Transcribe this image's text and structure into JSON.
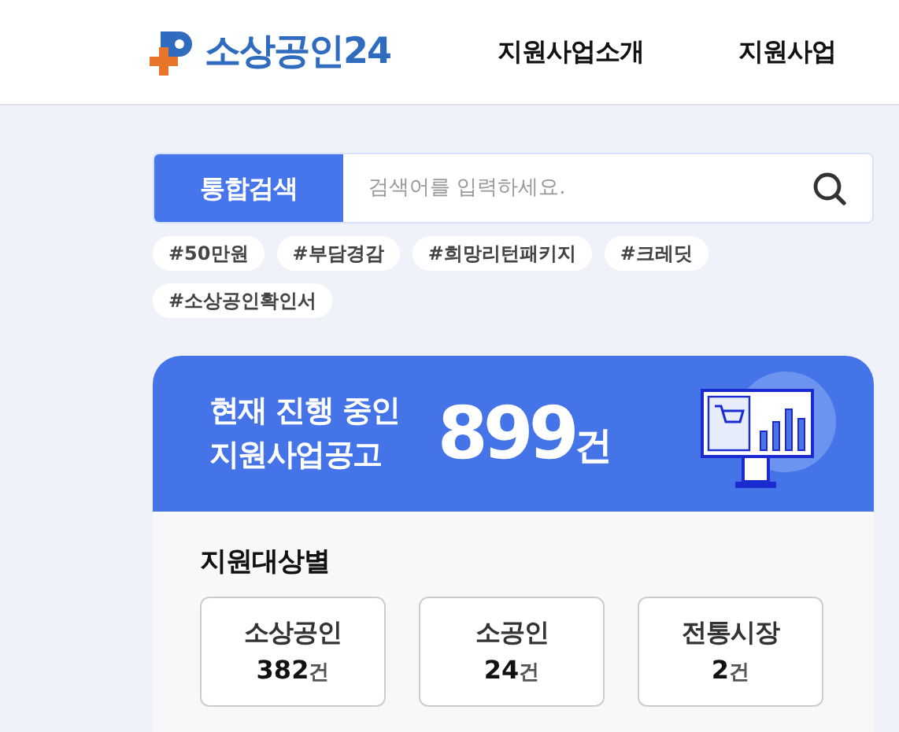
{
  "header": {
    "logo_text": "소상공인24",
    "nav": [
      "지원사업소개",
      "지원사업"
    ]
  },
  "search": {
    "label": "통합검색",
    "placeholder": "검색어를 입력하세요."
  },
  "tags": [
    "#50만원",
    "#부담경감",
    "#희망리턴패키지",
    "#크레딧",
    "#소상공인확인서"
  ],
  "summary": {
    "line_1": "현재 진행 중인",
    "line_2": "지원사업공고",
    "count": "899",
    "unit": "건"
  },
  "by_target": {
    "title": "지원대상별",
    "items": [
      {
        "label": "소상공인",
        "count": "382",
        "unit": "건"
      },
      {
        "label": "소공인",
        "count": "24",
        "unit": "건"
      },
      {
        "label": "전통시장",
        "count": "2",
        "unit": "건"
      }
    ]
  }
}
